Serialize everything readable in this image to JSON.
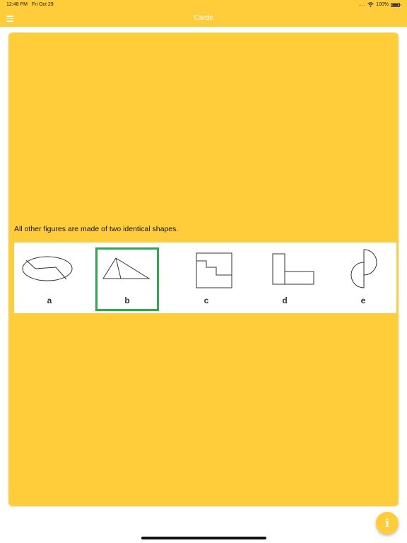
{
  "status_bar": {
    "time": "12:48 PM",
    "date": "Fri Oct 29",
    "signal": "....",
    "battery": "100%"
  },
  "nav": {
    "title": "Cards",
    "menu_icon": "hamburger-menu-icon"
  },
  "card": {
    "explanation": "All other figures are made of two identical shapes.",
    "options": [
      {
        "label": "a",
        "figure": "ellipse-split-by-zigzag"
      },
      {
        "label": "b",
        "figure": "triangle-split-by-line",
        "selected": true
      },
      {
        "label": "c",
        "figure": "square-with-stepped-cutout"
      },
      {
        "label": "d",
        "figure": "two-rectangles-l-shape"
      },
      {
        "label": "e",
        "figure": "two-half-circles"
      }
    ]
  },
  "info_button": {
    "label": "i",
    "icon": "info-icon"
  },
  "colors": {
    "accent": "#ffcd3a",
    "selected_border": "#2eaa4f",
    "text": "#111111"
  }
}
